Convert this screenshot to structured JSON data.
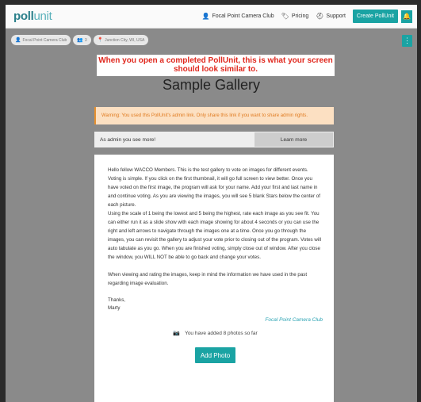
{
  "header": {
    "logo_bold": "poll",
    "logo_light": "unit",
    "nav": [
      {
        "icon": "user-icon",
        "glyph": "👤",
        "label": "Focal Point Camera Club"
      },
      {
        "icon": "tag-icon",
        "glyph": "🏷",
        "label": "Pricing"
      },
      {
        "icon": "lifebuoy-icon",
        "glyph": "⛑",
        "label": "Support"
      }
    ],
    "create_label": "Create PollUnit",
    "bell_glyph": "🔔"
  },
  "chips": [
    {
      "glyph": "👤",
      "label": "Focal Point Camera Club"
    },
    {
      "glyph": "👥",
      "label": "3"
    },
    {
      "glyph": "📍",
      "label": "Junction City, WI, USA"
    }
  ],
  "kebab_glyph": "⋮",
  "notice": {
    "line1": "When you open a completed PollUnit, this is what your screen",
    "line2": "should look similar to."
  },
  "gallery_title": "Sample Gallery",
  "warning": "Warning: You used this PollUnit's admin link. Only share this link if you want to share admin rights.",
  "admin": {
    "text": "As admin you see more!",
    "learn_label": "Learn more"
  },
  "description": {
    "p1": "Hello fellow WACCO Members. This is the test gallery to vote on images for different events. Voting is simple. If you click on the first thumbnail, it will go full screen to view better. Once you have voted on the first image, the program will ask for your name. Add your first and last name in and continue voting. As you are viewing the images, you will see 5 blank Stars below the center of each picture.",
    "p2": "Using the scale of 1 being the lowest and 5 being the highest, rate each image as you see fit. You can either run it as a slide show with each image showing for about 4 seconds or you can use the right and left arrows to navigate through the images one at a time. Once you go through the images, you can revisit the gallery to adjust your vote prior to closing out of the program. Votes will auto tabulate as you go. When you are finished voting, simply close out of window. After you close the window, you WILL NOT be able to go back and change your votes.",
    "p3": "When viewing and rating the images, keep in mind the information we have used in the past regarding image evaluation.",
    "thanks": "Thanks,",
    "name": "Marty"
  },
  "club_link": "Focal Point Camera Club",
  "photo_count": "You have added 8 photos so far",
  "camera_glyph": "📷",
  "add_photo_label": "Add Photo"
}
